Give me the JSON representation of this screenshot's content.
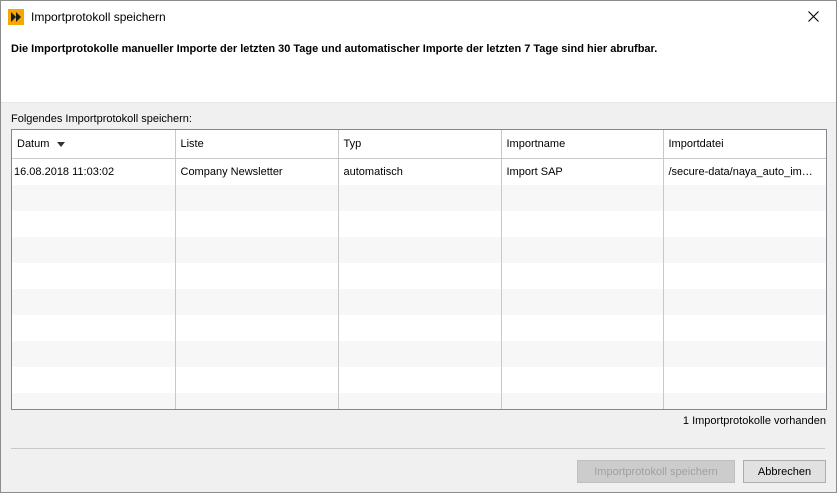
{
  "window": {
    "title": "Importprotokoll speichern"
  },
  "header": {
    "text": "Die Importprotokolle manueller Importe der letzten 30 Tage und automatischer Importe der letzten 7 Tage sind hier abrufbar."
  },
  "section_label": "Folgendes Importprotokoll speichern:",
  "table": {
    "columns": [
      "Datum",
      "Liste",
      "Typ",
      "Importname",
      "Importdatei"
    ],
    "sort_column": "Datum",
    "sort_direction": "descending",
    "rows": [
      [
        "16.08.2018 11:03:02",
        "Company Newsletter",
        "automatisch",
        "Import SAP",
        "/secure-data/naya_auto_im…"
      ]
    ]
  },
  "count_text": "1 Importprotokolle vorhanden",
  "buttons": {
    "save_label": "Importprotokoll speichern",
    "cancel_label": "Abbrechen"
  },
  "colors": {
    "app_icon": "#f5a800",
    "disabled_text": "#a0a0a0"
  }
}
